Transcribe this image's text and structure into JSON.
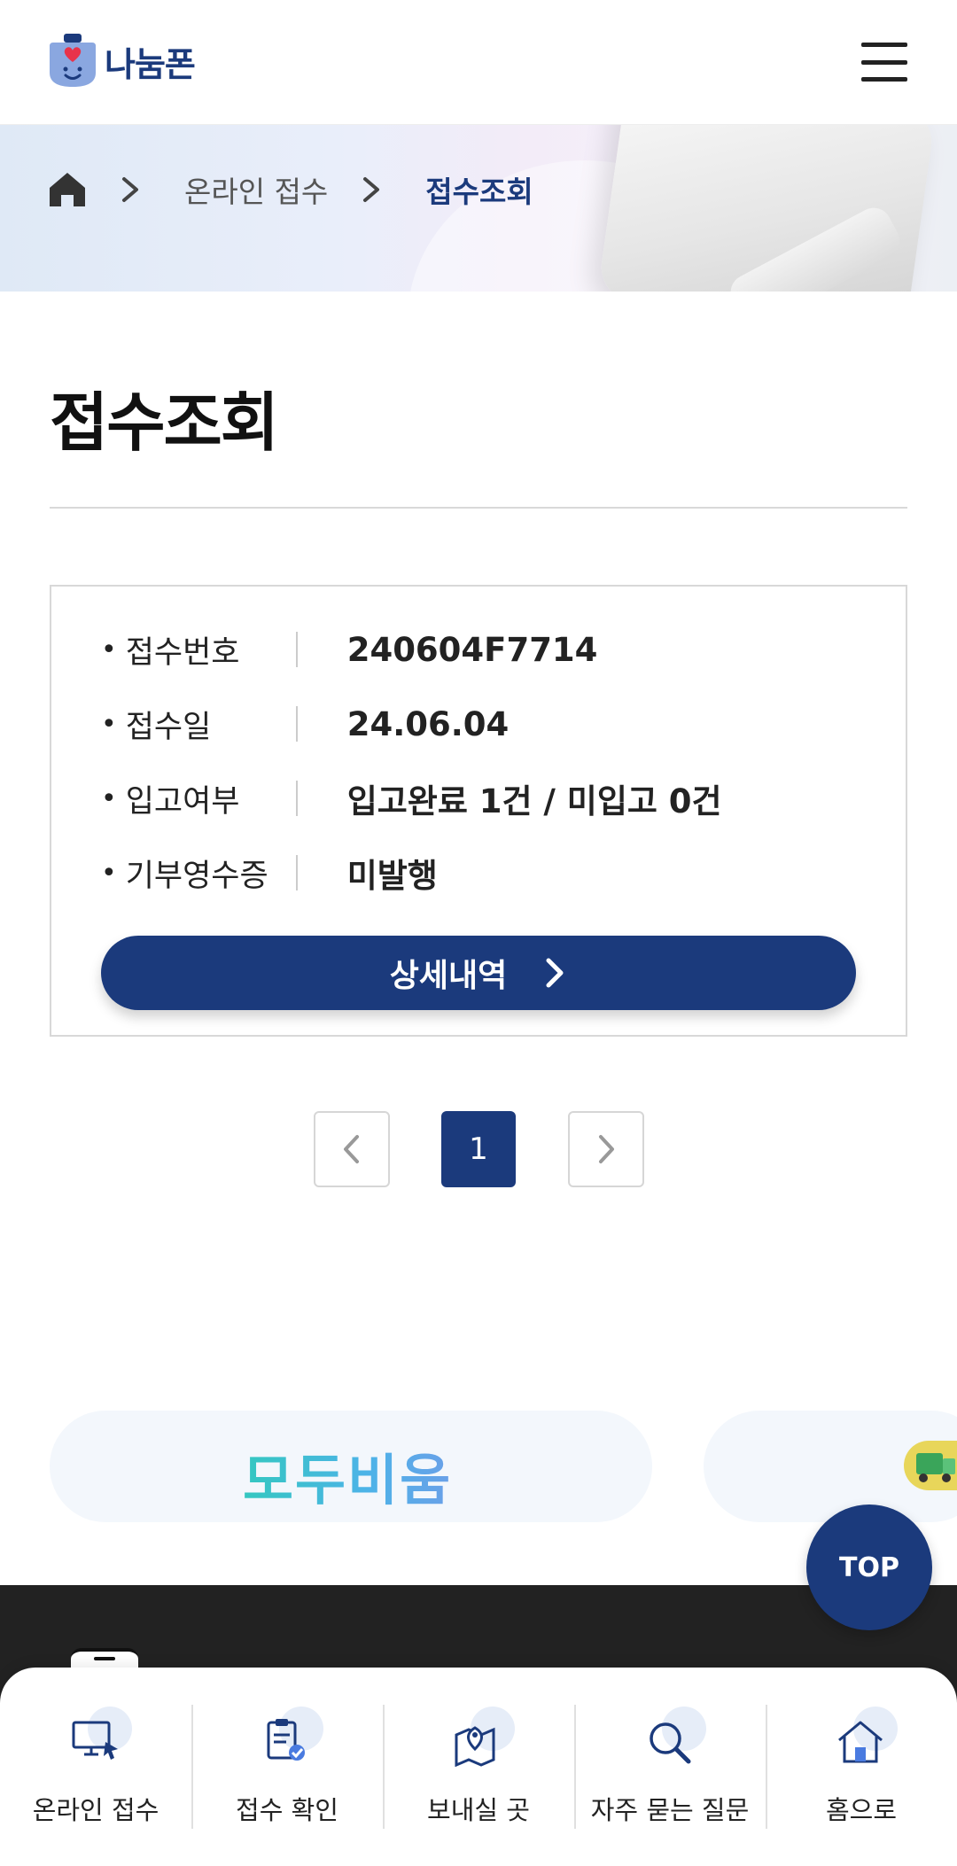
{
  "header": {
    "logo_text": "나눔폰",
    "menu_icon": "hamburger-menu-icon"
  },
  "breadcrumb": {
    "home_icon": "home-icon",
    "items": [
      "온라인 접수",
      "접수조회"
    ]
  },
  "page": {
    "title": "접수조회"
  },
  "receipt": {
    "rows": [
      {
        "label": "접수번호",
        "value": "240604F7714"
      },
      {
        "label": "접수일",
        "value": "24.06.04"
      },
      {
        "label": "입고여부",
        "value": "입고완료 1건 / 미입고 0건"
      },
      {
        "label": "기부영수증",
        "value": "미발행"
      }
    ],
    "detail_button": "상세내역"
  },
  "pagination": {
    "current_page": "1"
  },
  "banner": {
    "partner_logo": "모두비움"
  },
  "top_button": "TOP",
  "bottom_nav": {
    "items": [
      {
        "label": "온라인 접수",
        "icon": "monitor-cursor-icon"
      },
      {
        "label": "접수 확인",
        "icon": "clipboard-check-icon"
      },
      {
        "label": "보내실 곳",
        "icon": "map-pin-icon"
      },
      {
        "label": "자주 묻는 질문",
        "icon": "magnifier-icon"
      },
      {
        "label": "홈으로",
        "icon": "house-icon"
      }
    ]
  },
  "colors": {
    "brand": "#1b3a7c",
    "footer": "#222222"
  }
}
